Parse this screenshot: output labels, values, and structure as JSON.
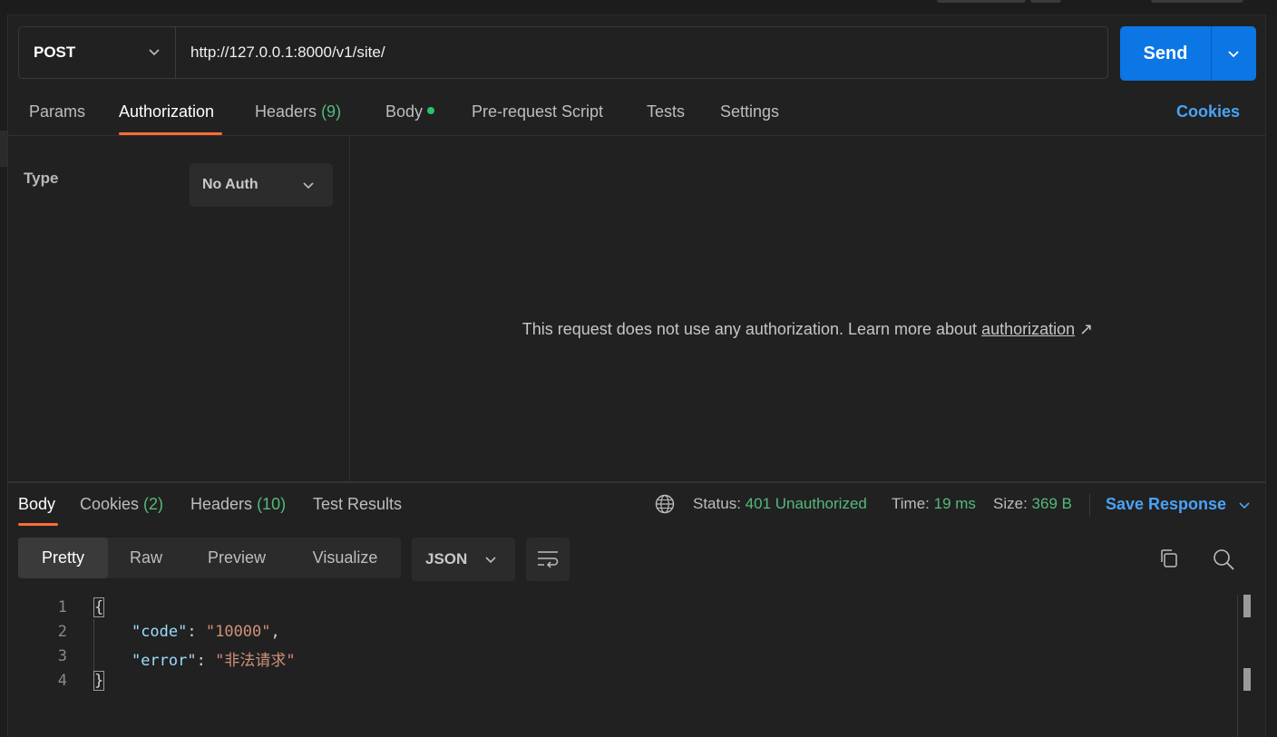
{
  "request": {
    "method": "POST",
    "url": "http://127.0.0.1:8000/v1/site/",
    "send_label": "Send"
  },
  "tabs": {
    "params": "Params",
    "authorization": "Authorization",
    "headers": "Headers",
    "headers_count": "(9)",
    "body": "Body",
    "prerequest": "Pre-request Script",
    "tests": "Tests",
    "settings": "Settings",
    "cookies": "Cookies"
  },
  "auth": {
    "type_label": "Type",
    "type_value": "No Auth",
    "message_prefix": "This request does not use any authorization. Learn more about ",
    "message_link": "authorization",
    "link_arrow": "↗"
  },
  "response": {
    "tabs": {
      "body": "Body",
      "cookies": "Cookies",
      "cookies_count": "(2)",
      "headers": "Headers",
      "headers_count": "(10)",
      "test_results": "Test Results"
    },
    "status_label": "Status:",
    "status_value": "401 Unauthorized",
    "time_label": "Time:",
    "time_value": "19 ms",
    "size_label": "Size:",
    "size_value": "369 B",
    "save_label": "Save Response",
    "views": [
      "Pretty",
      "Raw",
      "Preview",
      "Visualize"
    ],
    "format": "JSON",
    "code": {
      "line_numbers": [
        "1",
        "2",
        "3",
        "4"
      ],
      "open_brace": "{",
      "key1": "\"code\"",
      "val1": "\"10000\"",
      "key2": "\"error\"",
      "val2": "\"非法请求\"",
      "close_brace": "}"
    }
  },
  "colors": {
    "accent_orange": "#ff6c37",
    "send_blue": "#0b76e4",
    "link_blue": "#4aa3f7",
    "status_green": "#55b97b"
  }
}
